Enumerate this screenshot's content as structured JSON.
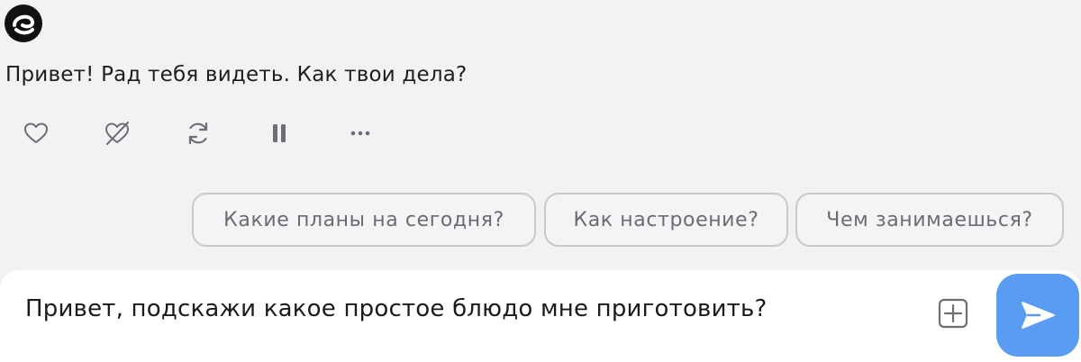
{
  "bot": {
    "avatar_icon": "bot-logo-icon",
    "message": "Привет! Рад тебя видеть. Как твои дела?"
  },
  "message_actions": [
    {
      "icon": "heart-icon",
      "label": "like"
    },
    {
      "icon": "heart-crossed-icon",
      "label": "dislike"
    },
    {
      "icon": "refresh-icon",
      "label": "regenerate"
    },
    {
      "icon": "pause-icon",
      "label": "pause"
    },
    {
      "icon": "more-icon",
      "label": "more"
    }
  ],
  "suggestions": [
    "Какие планы на сегодня?",
    "Как настроение?",
    "Чем занимаешься?"
  ],
  "composer": {
    "value": "Привет, подскажи какое простое блюдо мне приготовить?",
    "attach_icon": "plus-square-icon",
    "send_icon": "send-icon"
  },
  "colors": {
    "background": "#f2f2f4",
    "accent": "#5a9cf2",
    "chip_border": "#c9c9cc",
    "chip_text": "#6b6b70",
    "icon": "#6e6e73"
  }
}
